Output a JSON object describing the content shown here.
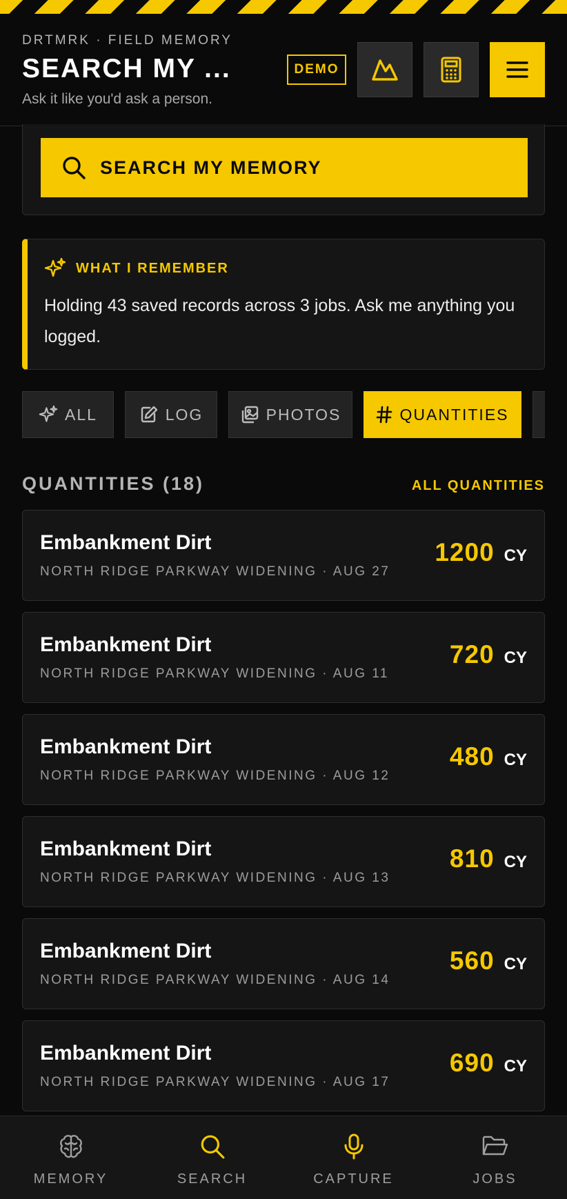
{
  "header": {
    "eyebrow": "DRTMRK · FIELD MEMORY",
    "title": "SEARCH MY ...",
    "subtitle": "Ask it like you'd ask a person.",
    "demo_badge": "DEMO",
    "icons": [
      "mountain-icon",
      "calculator-icon",
      "menu-icon"
    ]
  },
  "search": {
    "button_label": "SEARCH MY MEMORY"
  },
  "memory": {
    "heading": "WHAT I REMEMBER",
    "text": "Holding 43 saved records across 3 jobs. Ask me anything you logged."
  },
  "tabs": [
    {
      "label": "ALL",
      "icon": "sparkle-icon",
      "active": false
    },
    {
      "label": "LOG",
      "icon": "edit-icon",
      "active": false
    },
    {
      "label": "PHOTOS",
      "icon": "photos-icon",
      "active": false
    },
    {
      "label": "QUANTITIES",
      "icon": "hash-icon",
      "active": true
    }
  ],
  "section": {
    "title": "QUANTITIES (18)",
    "link": "ALL QUANTITIES"
  },
  "quantities": [
    {
      "name": "Embankment Dirt",
      "meta": "NORTH RIDGE PARKWAY WIDENING · AUG 27",
      "value": "1200",
      "unit": "CY"
    },
    {
      "name": "Embankment Dirt",
      "meta": "NORTH RIDGE PARKWAY WIDENING · AUG 11",
      "value": "720",
      "unit": "CY"
    },
    {
      "name": "Embankment Dirt",
      "meta": "NORTH RIDGE PARKWAY WIDENING · AUG 12",
      "value": "480",
      "unit": "CY"
    },
    {
      "name": "Embankment Dirt",
      "meta": "NORTH RIDGE PARKWAY WIDENING · AUG 13",
      "value": "810",
      "unit": "CY"
    },
    {
      "name": "Embankment Dirt",
      "meta": "NORTH RIDGE PARKWAY WIDENING · AUG 14",
      "value": "560",
      "unit": "CY"
    },
    {
      "name": "Embankment Dirt",
      "meta": "NORTH RIDGE PARKWAY WIDENING · AUG 17",
      "value": "690",
      "unit": "CY"
    }
  ],
  "bottom_nav": [
    {
      "label": "MEMORY",
      "icon": "brain-icon"
    },
    {
      "label": "SEARCH",
      "icon": "search-icon"
    },
    {
      "label": "CAPTURE",
      "icon": "microphone-icon"
    },
    {
      "label": "JOBS",
      "icon": "folder-icon"
    }
  ],
  "colors": {
    "accent": "#f5c800",
    "background": "#0a0a0a",
    "card": "#151515"
  }
}
